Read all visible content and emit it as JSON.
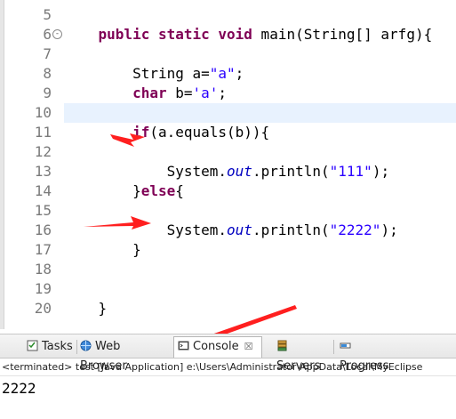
{
  "editor": {
    "lines": [
      {
        "num": "5",
        "segments": []
      },
      {
        "num": "6",
        "fold": "-",
        "segments": [
          {
            "t": "    ",
            "c": ""
          },
          {
            "t": "public static void",
            "c": "kw"
          },
          {
            "t": " main(String[] arfg){",
            "c": ""
          }
        ]
      },
      {
        "num": "7",
        "segments": []
      },
      {
        "num": "8",
        "segments": [
          {
            "t": "        String a=",
            "c": ""
          },
          {
            "t": "\"a\"",
            "c": "str"
          },
          {
            "t": ";",
            "c": ""
          }
        ]
      },
      {
        "num": "9",
        "segments": [
          {
            "t": "        ",
            "c": ""
          },
          {
            "t": "char",
            "c": "kw"
          },
          {
            "t": " b=",
            "c": ""
          },
          {
            "t": "'a'",
            "c": "str"
          },
          {
            "t": ";",
            "c": ""
          }
        ]
      },
      {
        "num": "10",
        "segments": []
      },
      {
        "num": "11",
        "segments": [
          {
            "t": "        ",
            "c": ""
          },
          {
            "t": "if",
            "c": "kw"
          },
          {
            "t": "(a.equals(b)){",
            "c": ""
          }
        ]
      },
      {
        "num": "12",
        "segments": []
      },
      {
        "num": "13",
        "segments": [
          {
            "t": "            System.",
            "c": ""
          },
          {
            "t": "out",
            "c": "fld"
          },
          {
            "t": ".println(",
            "c": ""
          },
          {
            "t": "\"111\"",
            "c": "str"
          },
          {
            "t": ");",
            "c": ""
          }
        ]
      },
      {
        "num": "14",
        "segments": [
          {
            "t": "        }",
            "c": ""
          },
          {
            "t": "else",
            "c": "kw"
          },
          {
            "t": "{",
            "c": ""
          }
        ]
      },
      {
        "num": "15",
        "segments": []
      },
      {
        "num": "16",
        "segments": [
          {
            "t": "            System.",
            "c": ""
          },
          {
            "t": "out",
            "c": "fld"
          },
          {
            "t": ".println(",
            "c": ""
          },
          {
            "t": "\"2222\"",
            "c": "str"
          },
          {
            "t": ");",
            "c": ""
          }
        ]
      },
      {
        "num": "17",
        "segments": [
          {
            "t": "        }",
            "c": ""
          }
        ]
      },
      {
        "num": "18",
        "segments": []
      },
      {
        "num": "19",
        "segments": []
      },
      {
        "num": "20",
        "segments": [
          {
            "t": "    }",
            "c": ""
          }
        ]
      }
    ]
  },
  "console": {
    "tabs": [
      {
        "label": "Tasks",
        "icon": "tasks-icon"
      },
      {
        "label": "Web Browser",
        "icon": "globe-icon"
      },
      {
        "label": "Console",
        "icon": "console-icon",
        "active": true,
        "close": "☒"
      },
      {
        "label": "Servers",
        "icon": "servers-icon"
      },
      {
        "label": "Progress",
        "icon": "progress-icon"
      }
    ],
    "info": "<terminated> test [Java Application] e:\\Users\\Administrator\\AppData\\Local\\MyEclipse",
    "output": "2222"
  },
  "annotations": {
    "arrow_color": "#ff1f1f",
    "count": 3
  }
}
